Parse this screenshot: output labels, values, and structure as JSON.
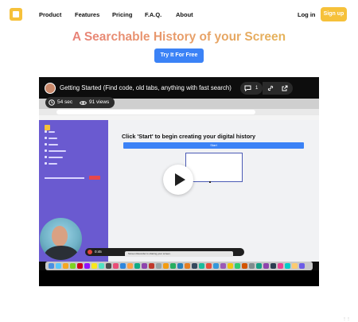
{
  "nav": {
    "logo": "square-logo-icon",
    "items": [
      "Product",
      "Features",
      "Pricing",
      "F.A.Q.",
      "About"
    ],
    "login": "Log in",
    "signup": "Sign up"
  },
  "hero": {
    "headline": "A Searchable History of your Screen",
    "cta": "Try It For Free"
  },
  "video": {
    "title": "Getting Started (Find code, old tabs, anything with fast search)",
    "comments_count": "1",
    "duration": "54 sec",
    "views": "91 views",
    "app_heading": "Click 'Start' to begin creating your digital history",
    "start_button": "Start",
    "recording_time": "0:45",
    "share_text": "Screen Recorder is sharing your screen."
  },
  "footer": {
    "mark": "⋮⋮"
  },
  "colors": {
    "accent_yellow": "#f6c13a",
    "cta_blue": "#3b82f6",
    "sidebar_purple": "#6a5ad0",
    "headline_gradient": [
      "#e88278",
      "#e5b35a"
    ]
  }
}
